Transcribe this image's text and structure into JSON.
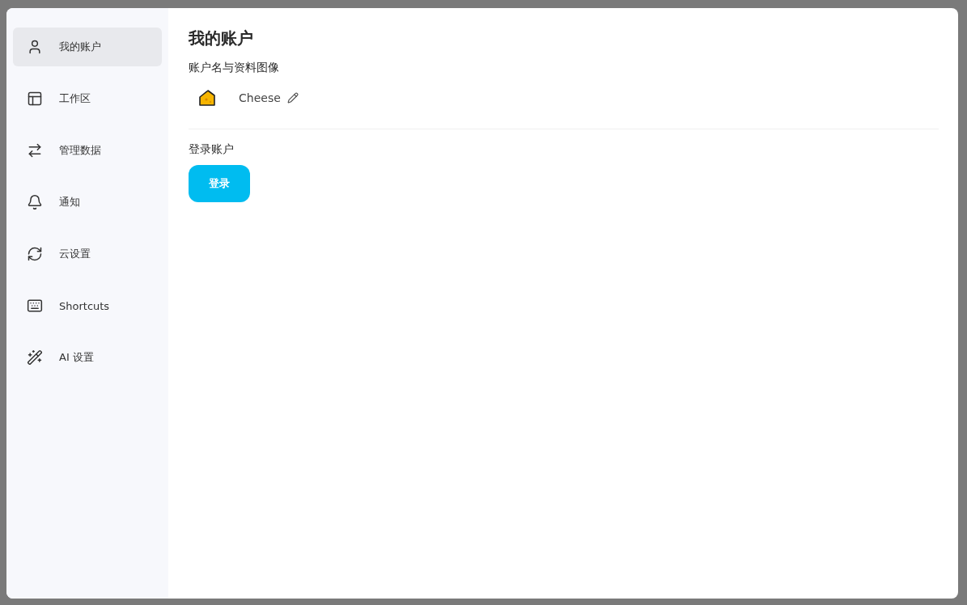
{
  "sidebar": {
    "items": [
      {
        "kind": "user",
        "label": "我的账户",
        "selected": true
      },
      {
        "kind": "layout",
        "label": "工作区",
        "selected": false
      },
      {
        "kind": "merge",
        "label": "管理数据",
        "selected": false
      },
      {
        "kind": "bell",
        "label": "通知",
        "selected": false
      },
      {
        "kind": "sync",
        "label": "云设置",
        "selected": false
      },
      {
        "kind": "keyboard",
        "label": "Shortcuts",
        "selected": false
      },
      {
        "kind": "wand",
        "label": "AI 设置",
        "selected": false
      }
    ]
  },
  "content": {
    "title": "我的账户",
    "profile_heading": "账户名与资料图像",
    "name": "Cheese",
    "login_heading": "登录账户",
    "login_button": "登录"
  }
}
